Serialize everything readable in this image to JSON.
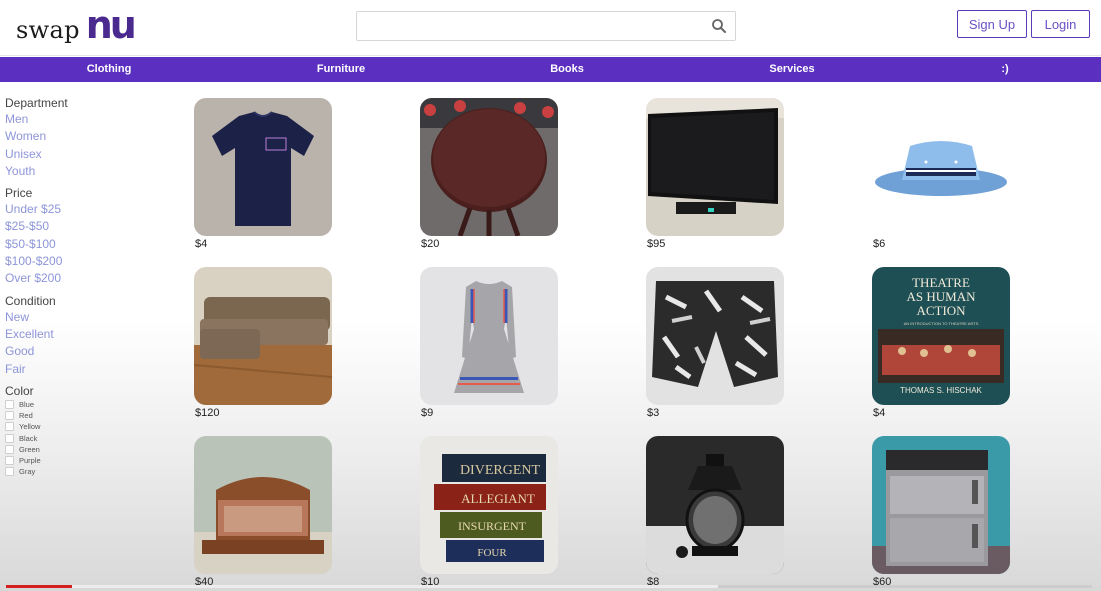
{
  "header": {
    "logo_text": "swap",
    "logo_mark": "nu",
    "search": {
      "value": "",
      "placeholder": ""
    },
    "signup_label": "Sign Up",
    "login_label": "Login"
  },
  "nav": {
    "items": [
      "Clothing",
      "Furniture",
      "Books",
      "Services",
      ":)"
    ]
  },
  "sidebar": {
    "department": {
      "heading": "Department",
      "items": [
        "Men",
        "Women",
        "Unisex",
        "Youth"
      ]
    },
    "price": {
      "heading": "Price",
      "items": [
        "Under $25",
        "$25-$50",
        "$50-$100",
        "$100-$200",
        "Over $200"
      ]
    },
    "condition": {
      "heading": "Condition",
      "items": [
        "New",
        "Excellent",
        "Good",
        "Fair"
      ]
    },
    "color": {
      "heading": "Color",
      "items": [
        "Blue",
        "Red",
        "Yellow",
        "Black",
        "Green",
        "Purple",
        "Gray"
      ]
    }
  },
  "products": [
    {
      "price": "$4",
      "image": "navy-t-shirt"
    },
    {
      "price": "$20",
      "image": "round-wooden-table"
    },
    {
      "price": "$95",
      "image": "flat-screen-tv"
    },
    {
      "price": "$6",
      "image": "blue-bucket-hat"
    },
    {
      "price": "$120",
      "image": "brown-sectional-sofa"
    },
    {
      "price": "$9",
      "image": "gray-striped-dress"
    },
    {
      "price": "$3",
      "image": "patterned-shorts"
    },
    {
      "price": "$4",
      "image": "theatre-book",
      "book_title": "THEATRE AS HUMAN ACTION",
      "book_subtitle": "AN INTRODUCTION TO THEATRE ARTS",
      "book_author": "THOMAS S. HISCHAK"
    },
    {
      "price": "$40",
      "image": "wooden-bed-frame"
    },
    {
      "price": "$10",
      "image": "divergent-book-stack",
      "spines": [
        "DIVERGENT",
        "ALLEGIANT",
        "INSURGENT",
        "FOUR"
      ]
    },
    {
      "price": "$8",
      "image": "black-lantern"
    },
    {
      "price": "$60",
      "image": "mini-fridge"
    }
  ],
  "video_progress": {
    "played_fraction": 0.06,
    "buffered_fraction": 0.655
  },
  "colors": {
    "accent": "#5b2fc0",
    "logo": "#4b2a8f",
    "link": "#8d95d8",
    "progress": "#d42020"
  }
}
